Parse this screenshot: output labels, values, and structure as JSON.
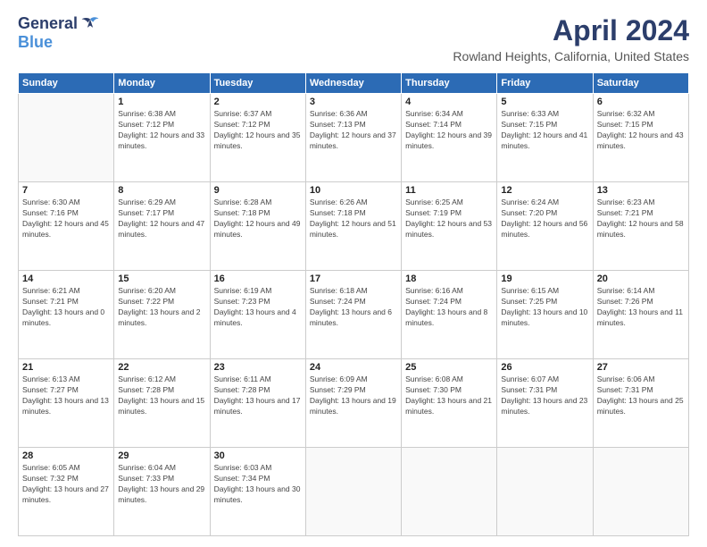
{
  "header": {
    "logo_general": "General",
    "logo_blue": "Blue",
    "title": "April 2024",
    "subtitle": "Rowland Heights, California, United States"
  },
  "columns": [
    "Sunday",
    "Monday",
    "Tuesday",
    "Wednesday",
    "Thursday",
    "Friday",
    "Saturday"
  ],
  "weeks": [
    [
      {
        "day": "",
        "sunrise": "",
        "sunset": "",
        "daylight": ""
      },
      {
        "day": "1",
        "sunrise": "Sunrise: 6:38 AM",
        "sunset": "Sunset: 7:12 PM",
        "daylight": "Daylight: 12 hours and 33 minutes."
      },
      {
        "day": "2",
        "sunrise": "Sunrise: 6:37 AM",
        "sunset": "Sunset: 7:12 PM",
        "daylight": "Daylight: 12 hours and 35 minutes."
      },
      {
        "day": "3",
        "sunrise": "Sunrise: 6:36 AM",
        "sunset": "Sunset: 7:13 PM",
        "daylight": "Daylight: 12 hours and 37 minutes."
      },
      {
        "day": "4",
        "sunrise": "Sunrise: 6:34 AM",
        "sunset": "Sunset: 7:14 PM",
        "daylight": "Daylight: 12 hours and 39 minutes."
      },
      {
        "day": "5",
        "sunrise": "Sunrise: 6:33 AM",
        "sunset": "Sunset: 7:15 PM",
        "daylight": "Daylight: 12 hours and 41 minutes."
      },
      {
        "day": "6",
        "sunrise": "Sunrise: 6:32 AM",
        "sunset": "Sunset: 7:15 PM",
        "daylight": "Daylight: 12 hours and 43 minutes."
      }
    ],
    [
      {
        "day": "7",
        "sunrise": "Sunrise: 6:30 AM",
        "sunset": "Sunset: 7:16 PM",
        "daylight": "Daylight: 12 hours and 45 minutes."
      },
      {
        "day": "8",
        "sunrise": "Sunrise: 6:29 AM",
        "sunset": "Sunset: 7:17 PM",
        "daylight": "Daylight: 12 hours and 47 minutes."
      },
      {
        "day": "9",
        "sunrise": "Sunrise: 6:28 AM",
        "sunset": "Sunset: 7:18 PM",
        "daylight": "Daylight: 12 hours and 49 minutes."
      },
      {
        "day": "10",
        "sunrise": "Sunrise: 6:26 AM",
        "sunset": "Sunset: 7:18 PM",
        "daylight": "Daylight: 12 hours and 51 minutes."
      },
      {
        "day": "11",
        "sunrise": "Sunrise: 6:25 AM",
        "sunset": "Sunset: 7:19 PM",
        "daylight": "Daylight: 12 hours and 53 minutes."
      },
      {
        "day": "12",
        "sunrise": "Sunrise: 6:24 AM",
        "sunset": "Sunset: 7:20 PM",
        "daylight": "Daylight: 12 hours and 56 minutes."
      },
      {
        "day": "13",
        "sunrise": "Sunrise: 6:23 AM",
        "sunset": "Sunset: 7:21 PM",
        "daylight": "Daylight: 12 hours and 58 minutes."
      }
    ],
    [
      {
        "day": "14",
        "sunrise": "Sunrise: 6:21 AM",
        "sunset": "Sunset: 7:21 PM",
        "daylight": "Daylight: 13 hours and 0 minutes."
      },
      {
        "day": "15",
        "sunrise": "Sunrise: 6:20 AM",
        "sunset": "Sunset: 7:22 PM",
        "daylight": "Daylight: 13 hours and 2 minutes."
      },
      {
        "day": "16",
        "sunrise": "Sunrise: 6:19 AM",
        "sunset": "Sunset: 7:23 PM",
        "daylight": "Daylight: 13 hours and 4 minutes."
      },
      {
        "day": "17",
        "sunrise": "Sunrise: 6:18 AM",
        "sunset": "Sunset: 7:24 PM",
        "daylight": "Daylight: 13 hours and 6 minutes."
      },
      {
        "day": "18",
        "sunrise": "Sunrise: 6:16 AM",
        "sunset": "Sunset: 7:24 PM",
        "daylight": "Daylight: 13 hours and 8 minutes."
      },
      {
        "day": "19",
        "sunrise": "Sunrise: 6:15 AM",
        "sunset": "Sunset: 7:25 PM",
        "daylight": "Daylight: 13 hours and 10 minutes."
      },
      {
        "day": "20",
        "sunrise": "Sunrise: 6:14 AM",
        "sunset": "Sunset: 7:26 PM",
        "daylight": "Daylight: 13 hours and 11 minutes."
      }
    ],
    [
      {
        "day": "21",
        "sunrise": "Sunrise: 6:13 AM",
        "sunset": "Sunset: 7:27 PM",
        "daylight": "Daylight: 13 hours and 13 minutes."
      },
      {
        "day": "22",
        "sunrise": "Sunrise: 6:12 AM",
        "sunset": "Sunset: 7:28 PM",
        "daylight": "Daylight: 13 hours and 15 minutes."
      },
      {
        "day": "23",
        "sunrise": "Sunrise: 6:11 AM",
        "sunset": "Sunset: 7:28 PM",
        "daylight": "Daylight: 13 hours and 17 minutes."
      },
      {
        "day": "24",
        "sunrise": "Sunrise: 6:09 AM",
        "sunset": "Sunset: 7:29 PM",
        "daylight": "Daylight: 13 hours and 19 minutes."
      },
      {
        "day": "25",
        "sunrise": "Sunrise: 6:08 AM",
        "sunset": "Sunset: 7:30 PM",
        "daylight": "Daylight: 13 hours and 21 minutes."
      },
      {
        "day": "26",
        "sunrise": "Sunrise: 6:07 AM",
        "sunset": "Sunset: 7:31 PM",
        "daylight": "Daylight: 13 hours and 23 minutes."
      },
      {
        "day": "27",
        "sunrise": "Sunrise: 6:06 AM",
        "sunset": "Sunset: 7:31 PM",
        "daylight": "Daylight: 13 hours and 25 minutes."
      }
    ],
    [
      {
        "day": "28",
        "sunrise": "Sunrise: 6:05 AM",
        "sunset": "Sunset: 7:32 PM",
        "daylight": "Daylight: 13 hours and 27 minutes."
      },
      {
        "day": "29",
        "sunrise": "Sunrise: 6:04 AM",
        "sunset": "Sunset: 7:33 PM",
        "daylight": "Daylight: 13 hours and 29 minutes."
      },
      {
        "day": "30",
        "sunrise": "Sunrise: 6:03 AM",
        "sunset": "Sunset: 7:34 PM",
        "daylight": "Daylight: 13 hours and 30 minutes."
      },
      {
        "day": "",
        "sunrise": "",
        "sunset": "",
        "daylight": ""
      },
      {
        "day": "",
        "sunrise": "",
        "sunset": "",
        "daylight": ""
      },
      {
        "day": "",
        "sunrise": "",
        "sunset": "",
        "daylight": ""
      },
      {
        "day": "",
        "sunrise": "",
        "sunset": "",
        "daylight": ""
      }
    ]
  ]
}
